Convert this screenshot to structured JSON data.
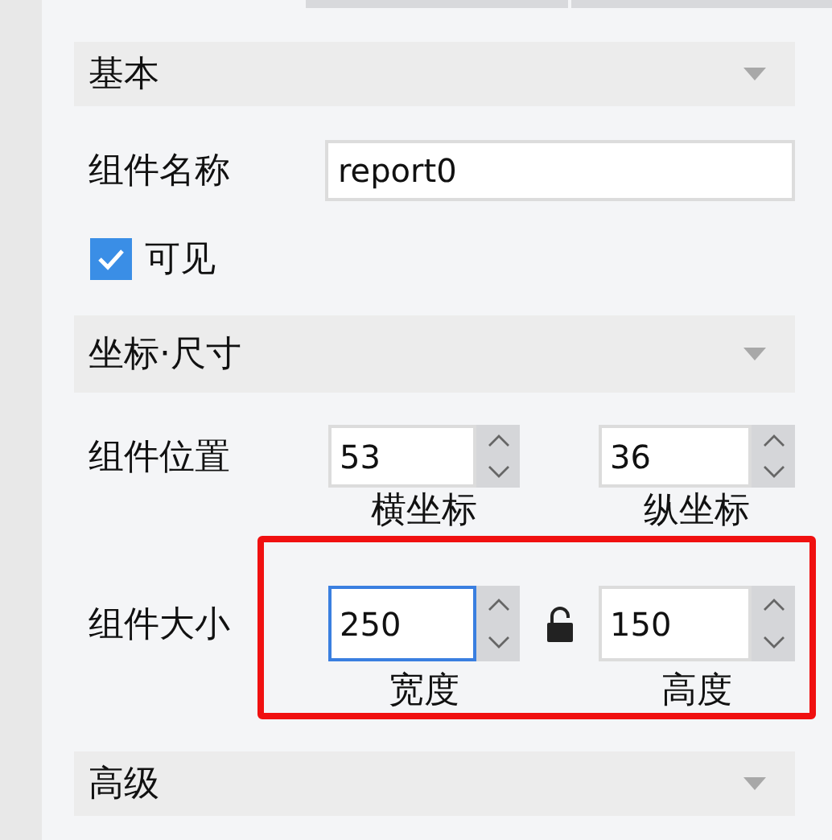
{
  "sections": [
    {
      "title": "基本",
      "rows": [
        {
          "kind": "text",
          "label": "组件名称",
          "value": "report0"
        },
        {
          "kind": "checkbox",
          "label": "可见",
          "checked": true
        }
      ]
    },
    {
      "title": "坐标·尺寸",
      "rows": [
        {
          "kind": "pair",
          "label": "组件位置",
          "fields": [
            {
              "value": "53",
              "caption": "横坐标",
              "focused": false
            },
            {
              "value": "36",
              "caption": "纵坐标",
              "focused": false
            }
          ]
        },
        {
          "kind": "pair",
          "label": "组件大小",
          "highlighted": true,
          "locked": false,
          "fields": [
            {
              "value": "250",
              "caption": "宽度",
              "focused": true
            },
            {
              "value": "150",
              "caption": "高度",
              "focused": false
            }
          ]
        }
      ]
    },
    {
      "title": "高级"
    }
  ]
}
